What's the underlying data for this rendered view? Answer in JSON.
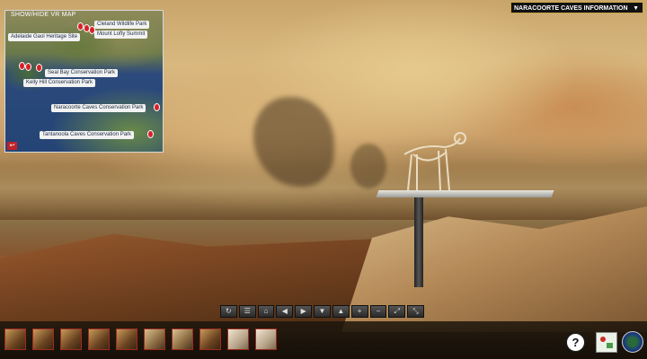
{
  "map": {
    "title": "SHOW/HIDE VR MAP",
    "back_icon": "back-arrow-icon",
    "locations": [
      {
        "label": "Cleland Wildlife Park"
      },
      {
        "label": "Mount Lofty Summit"
      },
      {
        "label": "Adelaide Gaol Heritage Site"
      },
      {
        "label": "Seal Bay Conservation Park"
      },
      {
        "label": "Kelly Hill Conservation Park"
      },
      {
        "label": "Naracoorte Caves Conservation Park"
      },
      {
        "label": "Tantanoola Caves Conservation Park"
      }
    ]
  },
  "info": {
    "dropdown_label": "NARACOORTE CAVES INFORMATION",
    "chevron": "▼"
  },
  "toolbar": {
    "buttons": [
      {
        "name": "autorotate-icon",
        "glyph": "↻"
      },
      {
        "name": "info-icon",
        "glyph": "☰"
      },
      {
        "name": "home-icon",
        "glyph": "⌂"
      },
      {
        "name": "pan-left-icon",
        "glyph": "◀"
      },
      {
        "name": "pan-right-icon",
        "glyph": "▶"
      },
      {
        "name": "pan-down-icon",
        "glyph": "▼"
      },
      {
        "name": "pan-up-icon",
        "glyph": "▲"
      },
      {
        "name": "zoom-in-icon",
        "glyph": "+"
      },
      {
        "name": "zoom-out-icon",
        "glyph": "−"
      },
      {
        "name": "fullscreen-icon",
        "glyph": "⤢"
      },
      {
        "name": "expand-icon",
        "glyph": "⤡"
      }
    ]
  },
  "thumbnails": [
    {
      "name": "thumb-1"
    },
    {
      "name": "thumb-2"
    },
    {
      "name": "thumb-3"
    },
    {
      "name": "thumb-4"
    },
    {
      "name": "thumb-5"
    },
    {
      "name": "thumb-6"
    },
    {
      "name": "thumb-7"
    },
    {
      "name": "thumb-8"
    },
    {
      "name": "thumb-9"
    },
    {
      "name": "thumb-10"
    }
  ],
  "help": {
    "label": "?"
  },
  "colors": {
    "accent": "#c9a44a",
    "pin": "#d8202a",
    "thumb_border": "#a12a20"
  }
}
